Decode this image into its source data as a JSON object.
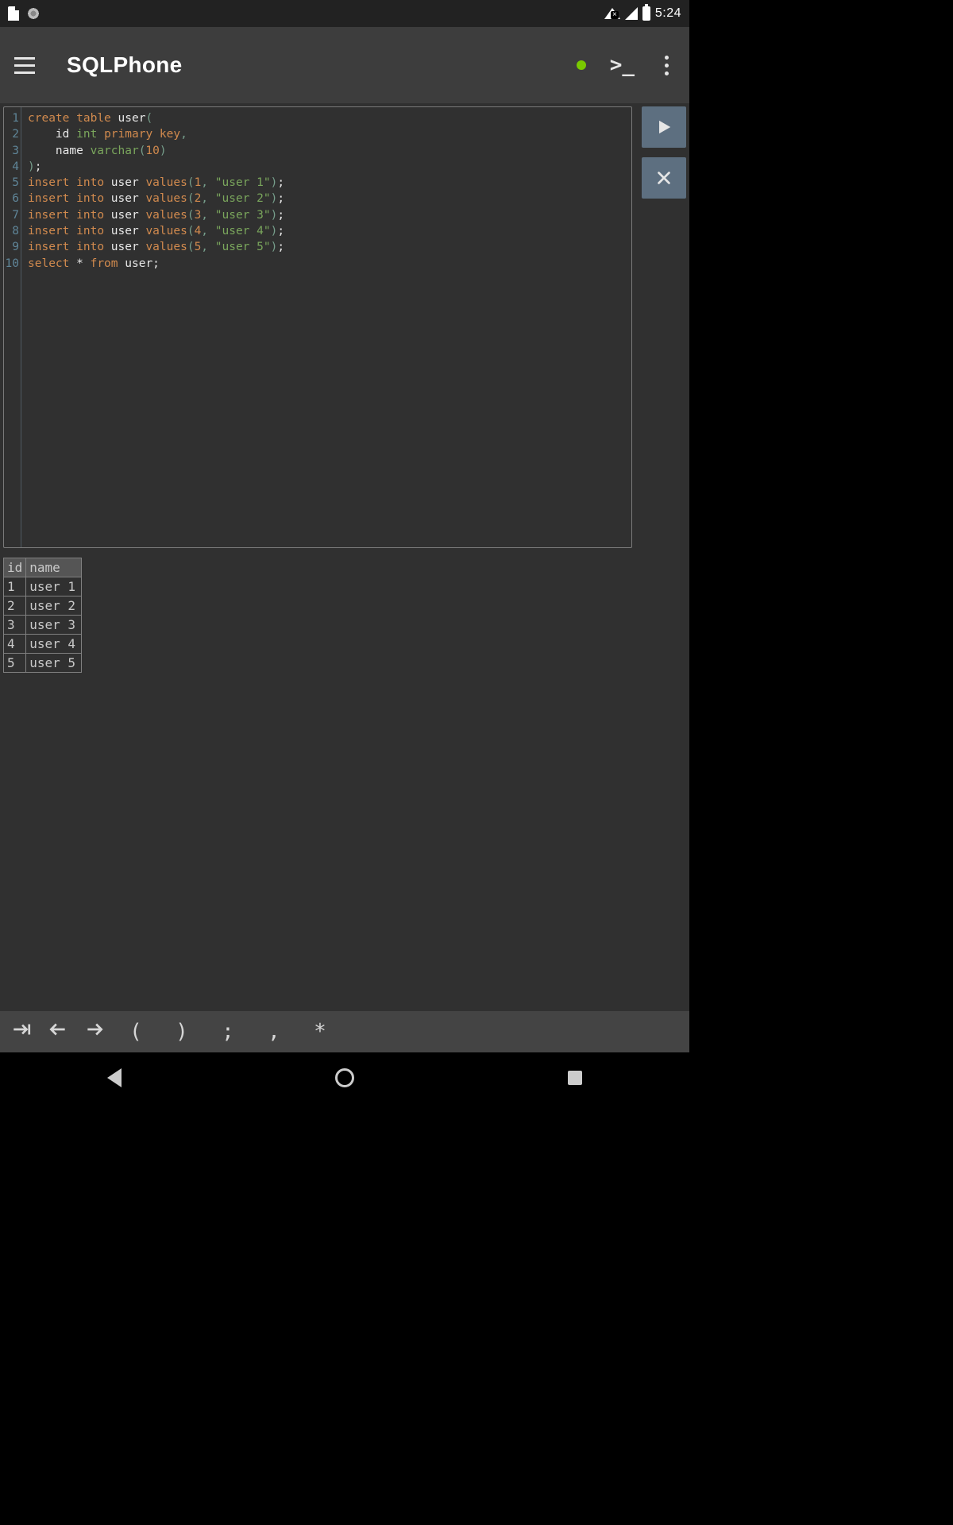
{
  "status": {
    "time": "5:24"
  },
  "app": {
    "title": "SQLPhone"
  },
  "editor": {
    "line_numbers": [
      "1",
      "2",
      "3",
      "4",
      "5",
      "6",
      "7",
      "8",
      "9",
      "10"
    ],
    "tokens": [
      [
        {
          "c": "kw",
          "t": "create"
        },
        {
          "c": "",
          "t": " "
        },
        {
          "c": "kw",
          "t": "table"
        },
        {
          "c": "",
          "t": " "
        },
        {
          "c": "id",
          "t": "user"
        },
        {
          "c": "pun",
          "t": "("
        }
      ],
      [
        {
          "c": "",
          "t": "    "
        },
        {
          "c": "id",
          "t": "id"
        },
        {
          "c": "",
          "t": " "
        },
        {
          "c": "type",
          "t": "int"
        },
        {
          "c": "",
          "t": " "
        },
        {
          "c": "kw",
          "t": "primary"
        },
        {
          "c": "",
          "t": " "
        },
        {
          "c": "kw",
          "t": "key"
        },
        {
          "c": "pun",
          "t": ","
        }
      ],
      [
        {
          "c": "",
          "t": "    "
        },
        {
          "c": "id",
          "t": "name"
        },
        {
          "c": "",
          "t": " "
        },
        {
          "c": "type",
          "t": "varchar"
        },
        {
          "c": "pun",
          "t": "("
        },
        {
          "c": "num",
          "t": "10"
        },
        {
          "c": "pun",
          "t": ")"
        }
      ],
      [
        {
          "c": "pun",
          "t": ")"
        },
        {
          "c": "id",
          "t": ";"
        }
      ],
      [
        {
          "c": "kw",
          "t": "insert"
        },
        {
          "c": "",
          "t": " "
        },
        {
          "c": "kw",
          "t": "into"
        },
        {
          "c": "",
          "t": " "
        },
        {
          "c": "id",
          "t": "user"
        },
        {
          "c": "",
          "t": " "
        },
        {
          "c": "kw",
          "t": "values"
        },
        {
          "c": "pun",
          "t": "("
        },
        {
          "c": "num",
          "t": "1"
        },
        {
          "c": "pun",
          "t": ","
        },
        {
          "c": "",
          "t": " "
        },
        {
          "c": "str",
          "t": "\"user 1\""
        },
        {
          "c": "pun",
          "t": ")"
        },
        {
          "c": "id",
          "t": ";"
        }
      ],
      [
        {
          "c": "kw",
          "t": "insert"
        },
        {
          "c": "",
          "t": " "
        },
        {
          "c": "kw",
          "t": "into"
        },
        {
          "c": "",
          "t": " "
        },
        {
          "c": "id",
          "t": "user"
        },
        {
          "c": "",
          "t": " "
        },
        {
          "c": "kw",
          "t": "values"
        },
        {
          "c": "pun",
          "t": "("
        },
        {
          "c": "num",
          "t": "2"
        },
        {
          "c": "pun",
          "t": ","
        },
        {
          "c": "",
          "t": " "
        },
        {
          "c": "str",
          "t": "\"user 2\""
        },
        {
          "c": "pun",
          "t": ")"
        },
        {
          "c": "id",
          "t": ";"
        }
      ],
      [
        {
          "c": "kw",
          "t": "insert"
        },
        {
          "c": "",
          "t": " "
        },
        {
          "c": "kw",
          "t": "into"
        },
        {
          "c": "",
          "t": " "
        },
        {
          "c": "id",
          "t": "user"
        },
        {
          "c": "",
          "t": " "
        },
        {
          "c": "kw",
          "t": "values"
        },
        {
          "c": "pun",
          "t": "("
        },
        {
          "c": "num",
          "t": "3"
        },
        {
          "c": "pun",
          "t": ","
        },
        {
          "c": "",
          "t": " "
        },
        {
          "c": "str",
          "t": "\"user 3\""
        },
        {
          "c": "pun",
          "t": ")"
        },
        {
          "c": "id",
          "t": ";"
        }
      ],
      [
        {
          "c": "kw",
          "t": "insert"
        },
        {
          "c": "",
          "t": " "
        },
        {
          "c": "kw",
          "t": "into"
        },
        {
          "c": "",
          "t": " "
        },
        {
          "c": "id",
          "t": "user"
        },
        {
          "c": "",
          "t": " "
        },
        {
          "c": "kw",
          "t": "values"
        },
        {
          "c": "pun",
          "t": "("
        },
        {
          "c": "num",
          "t": "4"
        },
        {
          "c": "pun",
          "t": ","
        },
        {
          "c": "",
          "t": " "
        },
        {
          "c": "str",
          "t": "\"user 4\""
        },
        {
          "c": "pun",
          "t": ")"
        },
        {
          "c": "id",
          "t": ";"
        }
      ],
      [
        {
          "c": "kw",
          "t": "insert"
        },
        {
          "c": "",
          "t": " "
        },
        {
          "c": "kw",
          "t": "into"
        },
        {
          "c": "",
          "t": " "
        },
        {
          "c": "id",
          "t": "user"
        },
        {
          "c": "",
          "t": " "
        },
        {
          "c": "kw",
          "t": "values"
        },
        {
          "c": "pun",
          "t": "("
        },
        {
          "c": "num",
          "t": "5"
        },
        {
          "c": "pun",
          "t": ","
        },
        {
          "c": "",
          "t": " "
        },
        {
          "c": "str",
          "t": "\"user 5\""
        },
        {
          "c": "pun",
          "t": ")"
        },
        {
          "c": "id",
          "t": ";"
        }
      ],
      [
        {
          "c": "kw",
          "t": "select"
        },
        {
          "c": "",
          "t": " "
        },
        {
          "c": "id",
          "t": "*"
        },
        {
          "c": "",
          "t": " "
        },
        {
          "c": "kw",
          "t": "from"
        },
        {
          "c": "",
          "t": " "
        },
        {
          "c": "id",
          "t": "user"
        },
        {
          "c": "id",
          "t": ";"
        }
      ]
    ]
  },
  "result": {
    "columns": [
      "id",
      "name"
    ],
    "rows": [
      [
        "1",
        "user 1"
      ],
      [
        "2",
        "user 2"
      ],
      [
        "3",
        "user 3"
      ],
      [
        "4",
        "user 4"
      ],
      [
        "5",
        "user 5"
      ]
    ]
  },
  "symbar": {
    "keys": [
      "(",
      ")",
      ";",
      ",",
      "*"
    ]
  }
}
